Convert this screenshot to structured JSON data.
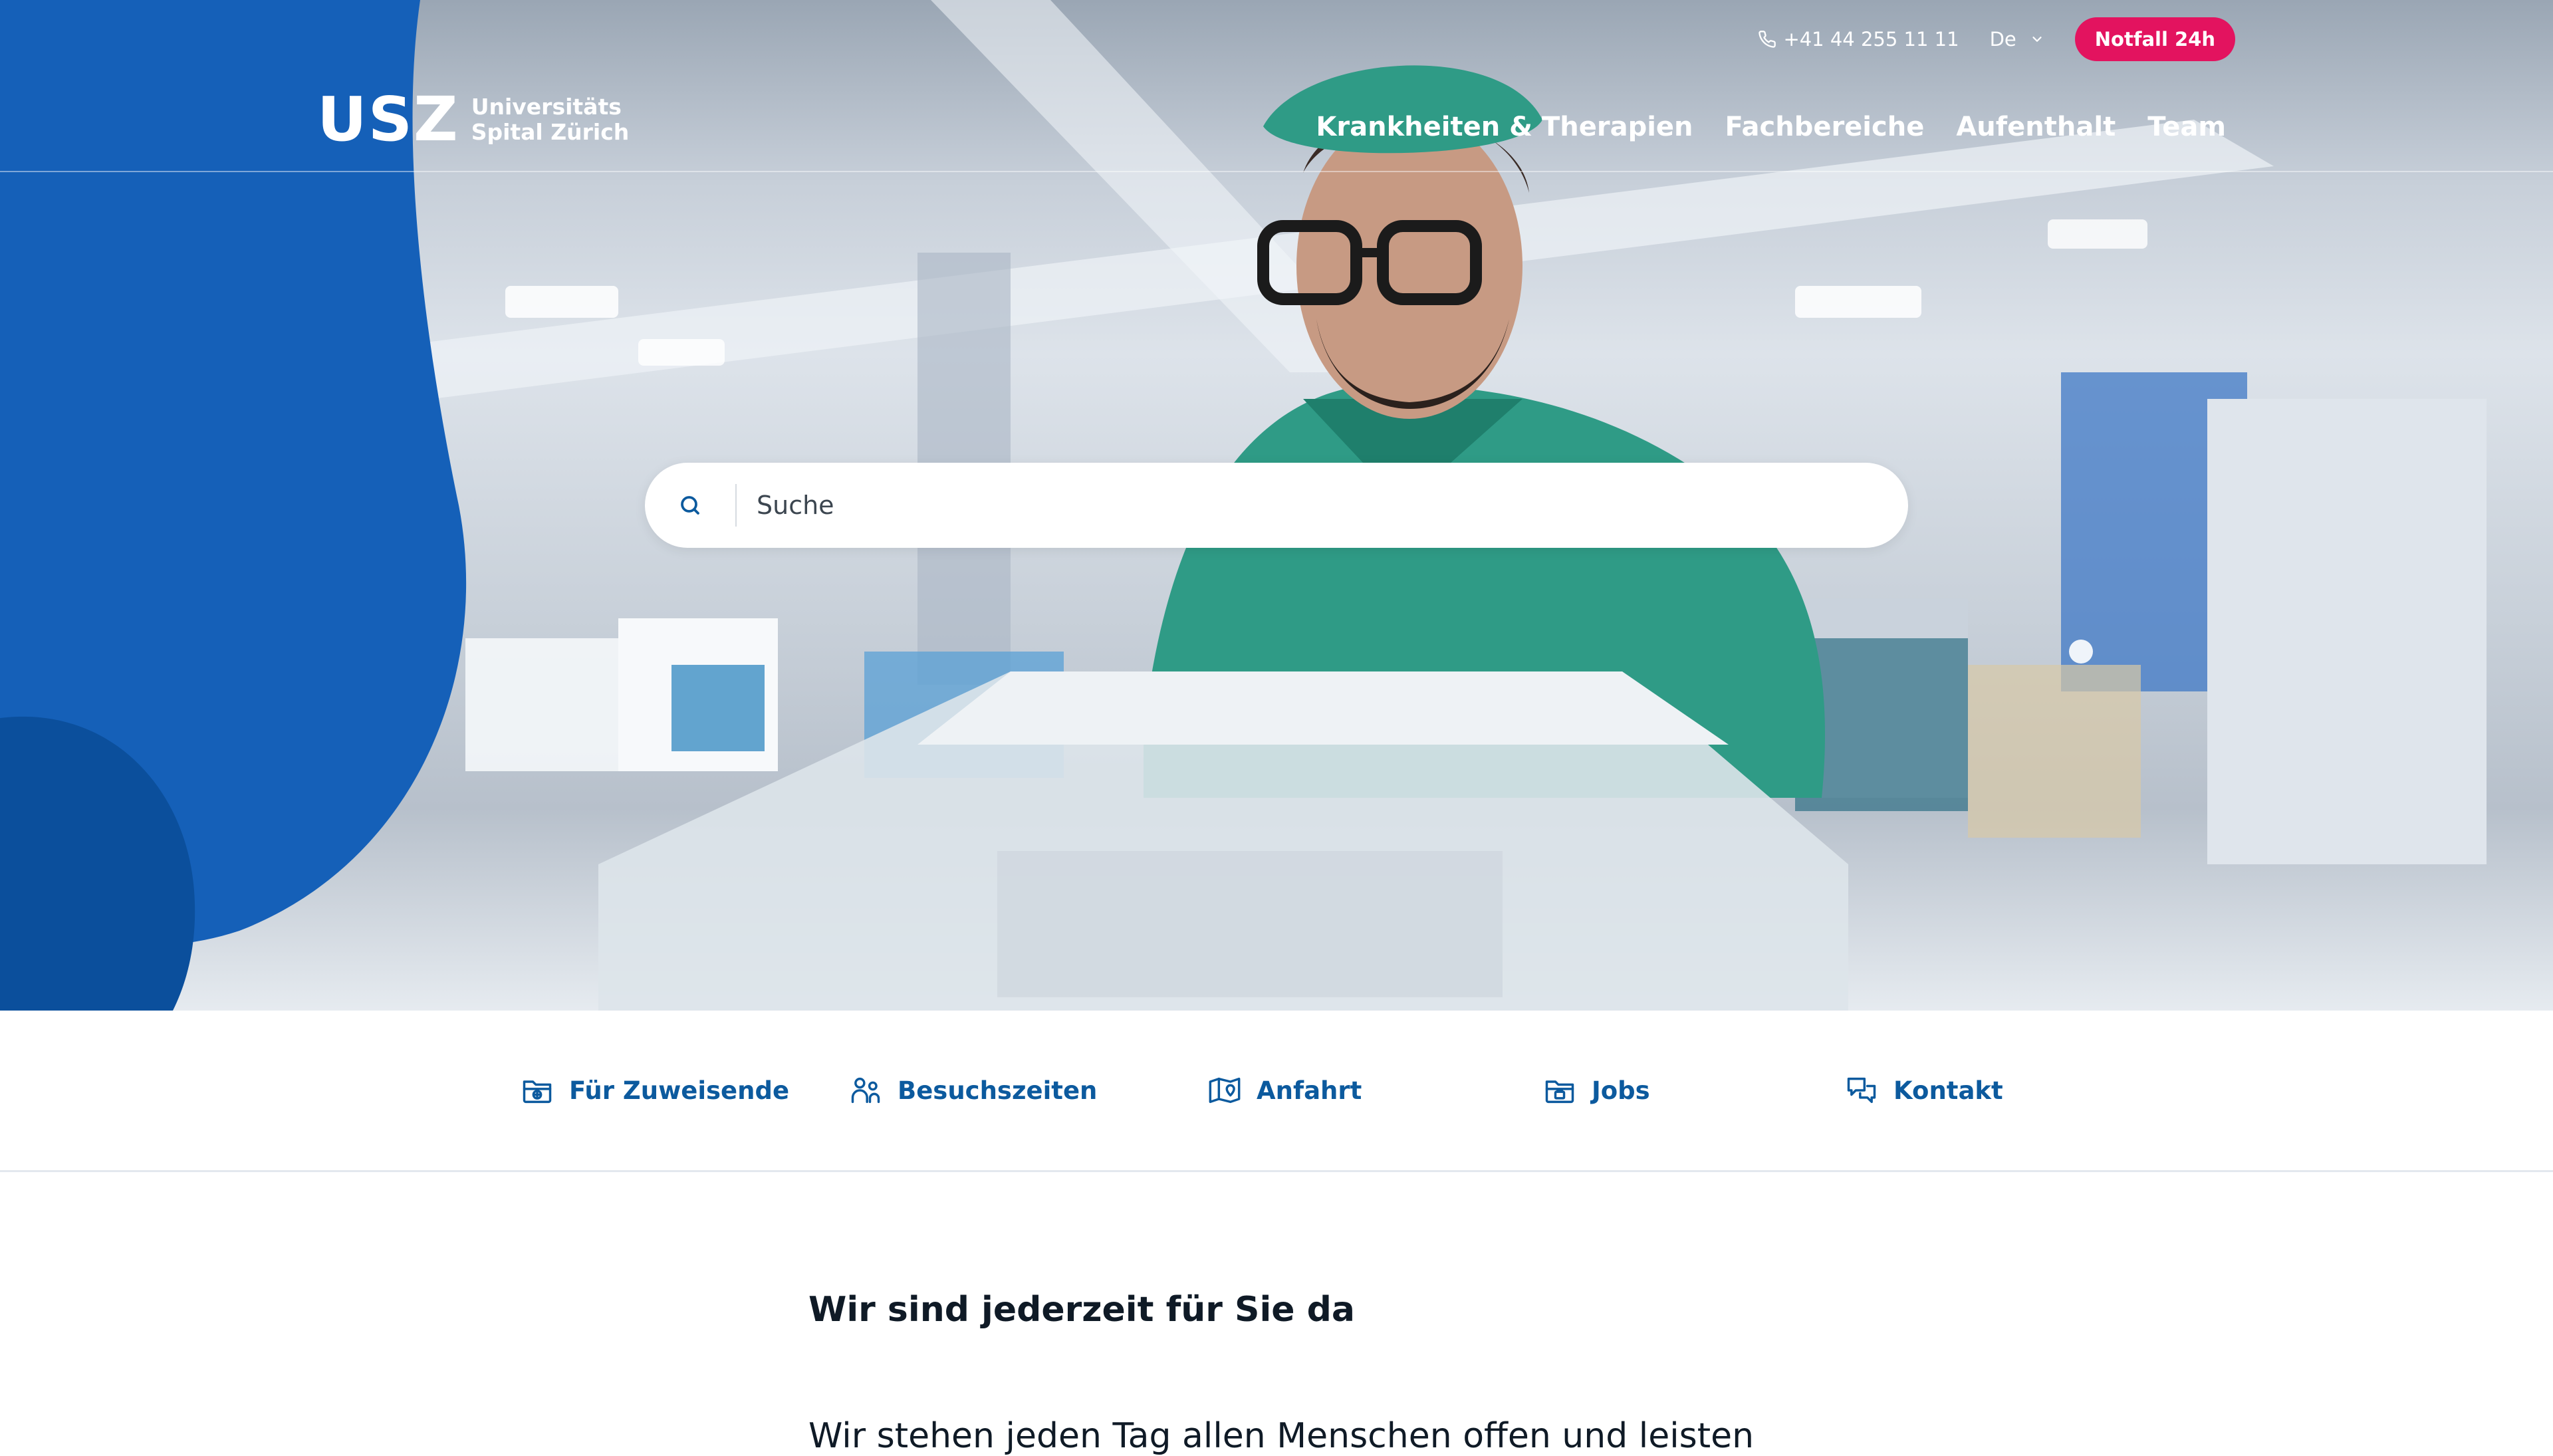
{
  "header": {
    "logo": {
      "mark": "USZ",
      "line1": "Universitäts",
      "line2": "Spital Zürich"
    },
    "phone": "+41 44 255 11 11",
    "language": "De",
    "emergency": "Notfall 24h",
    "nav": [
      "Krankheiten & Therapien",
      "Fachbereiche",
      "Aufenthalt",
      "Team"
    ]
  },
  "search": {
    "placeholder": "Suche"
  },
  "quicklinks": [
    {
      "label": "Für Zuweisende",
      "icon": "folder-plus-icon"
    },
    {
      "label": "Besuchszeiten",
      "icon": "visitors-icon"
    },
    {
      "label": "Anfahrt",
      "icon": "map-pin-icon"
    },
    {
      "label": "Jobs",
      "icon": "briefcase-folder-icon"
    },
    {
      "label": "Kontakt",
      "icon": "chat-bubbles-icon"
    }
  ],
  "intro": {
    "title": "Wir sind jederzeit für Sie da",
    "text": "Wir stehen jeden Tag allen Menschen offen und leisten"
  },
  "colors": {
    "brand_blue": "#1560b8",
    "dark_blue": "#0b4f9c",
    "link_blue": "#0c5a9e",
    "emergency_pink": "#e3135f",
    "scrubs_green": "#2f9b86"
  }
}
